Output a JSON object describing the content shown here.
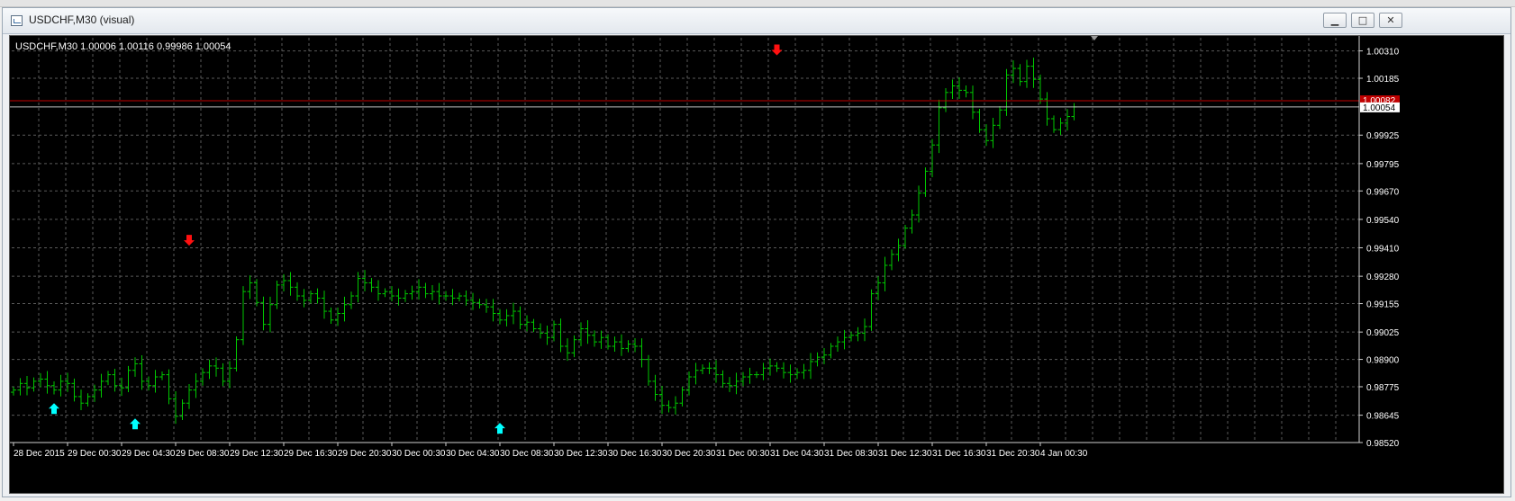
{
  "window": {
    "title": "USDCHF,M30 (visual)",
    "minimize_glyph": "▁",
    "maximize_glyph": "□",
    "close_glyph": "✕"
  },
  "colors": {
    "background": "#000000",
    "bars": "#00c800",
    "grid": "#5a5a5a",
    "axis_text": "#ffffff",
    "bid_line": "#c00000",
    "ask_line": "#c0c0c0",
    "buy_arrow": "#00ffff",
    "sell_arrow": "#ff1010"
  },
  "chart_data": {
    "type": "ohlc",
    "info_label": "USDCHF,M30  1.00006 1.00116 0.99986 1.00054",
    "ylim": [
      0.9852,
      1.0037
    ],
    "y_ticks": [
      "1.00310",
      "1.00185",
      "0.99925",
      "0.99795",
      "0.99670",
      "0.99540",
      "0.99410",
      "0.99280",
      "0.99155",
      "0.99025",
      "0.98900",
      "0.98775",
      "0.98645",
      "0.98520"
    ],
    "x_ticks": [
      "28 Dec 2015",
      "29 Dec 00:30",
      "29 Dec 04:30",
      "29 Dec 08:30",
      "29 Dec 12:30",
      "29 Dec 16:30",
      "29 Dec 20:30",
      "30 Dec 00:30",
      "30 Dec 04:30",
      "30 Dec 08:30",
      "30 Dec 12:30",
      "30 Dec 16:30",
      "30 Dec 20:30",
      "31 Dec 00:30",
      "31 Dec 04:30",
      "31 Dec 08:30",
      "31 Dec 12:30",
      "31 Dec 16:30",
      "31 Dec 20:30",
      "4 Jan 00:30"
    ],
    "x_tick_bar_index": [
      0,
      8,
      16,
      24,
      32,
      40,
      48,
      56,
      64,
      72,
      80,
      88,
      96,
      104,
      112,
      120,
      128,
      136,
      144,
      152
    ],
    "bid_price": "1.00082",
    "ask_price": "1.00054",
    "grid": true,
    "series_close": [
      0.9876,
      0.9879,
      0.9877,
      0.988,
      0.9881,
      0.9878,
      0.9876,
      0.988,
      0.9879,
      0.9873,
      0.987,
      0.9873,
      0.9876,
      0.988,
      0.9883,
      0.9878,
      0.9877,
      0.9885,
      0.9888,
      0.988,
      0.9878,
      0.9882,
      0.9883,
      0.9872,
      0.9864,
      0.987,
      0.9876,
      0.988,
      0.9884,
      0.9887,
      0.9886,
      0.988,
      0.9886,
      0.9899,
      0.9921,
      0.9925,
      0.9916,
      0.9906,
      0.9915,
      0.9924,
      0.9926,
      0.9923,
      0.9919,
      0.9917,
      0.992,
      0.9918,
      0.9912,
      0.9908,
      0.9911,
      0.9915,
      0.9919,
      0.9927,
      0.9925,
      0.9923,
      0.992,
      0.9921,
      0.9919,
      0.9918,
      0.992,
      0.9921,
      0.9923,
      0.992,
      0.9921,
      0.9919,
      0.9919,
      0.9918,
      0.9919,
      0.9917,
      0.9916,
      0.9915,
      0.9914,
      0.9911,
      0.9908,
      0.991,
      0.9912,
      0.9906,
      0.9907,
      0.9904,
      0.9902,
      0.99,
      0.9906,
      0.9896,
      0.9893,
      0.9899,
      0.9904,
      0.9901,
      0.9898,
      0.99,
      0.9896,
      0.9898,
      0.9895,
      0.9897,
      0.9896,
      0.989,
      0.988,
      0.9874,
      0.9869,
      0.9868,
      0.987,
      0.9876,
      0.9882,
      0.9885,
      0.9886,
      0.9886,
      0.9883,
      0.9879,
      0.9878,
      0.988,
      0.9882,
      0.9883,
      0.9883,
      0.9886,
      0.9887,
      0.9886,
      0.9884,
      0.9883,
      0.9884,
      0.9885,
      0.9889,
      0.9891,
      0.9892,
      0.9896,
      0.9898,
      0.99,
      0.9901,
      0.9902,
      0.9905,
      0.992,
      0.9925,
      0.9933,
      0.9938,
      0.9942,
      0.995,
      0.9956,
      0.9966,
      0.9976,
      0.9988,
      1.0005,
      1.0012,
      1.0015,
      1.0013,
      1.0012,
      1.0003,
      0.9995,
      0.999,
      0.9997,
      1.0004,
      1.002,
      1.0023,
      1.0017,
      1.0024,
      1.0018,
      1.0009,
      1.0,
      0.9995,
      0.9998,
      1.0001,
      1.00054
    ],
    "signals": [
      {
        "type": "buy",
        "bar_index": 6,
        "price": 0.987
      },
      {
        "type": "buy",
        "bar_index": 18,
        "price": 0.9863
      },
      {
        "type": "sell",
        "bar_index": 26,
        "price": 0.9942
      },
      {
        "type": "buy",
        "bar_index": 72,
        "price": 0.9861
      },
      {
        "type": "sell",
        "bar_index": 113,
        "price": 1.0029
      }
    ]
  }
}
